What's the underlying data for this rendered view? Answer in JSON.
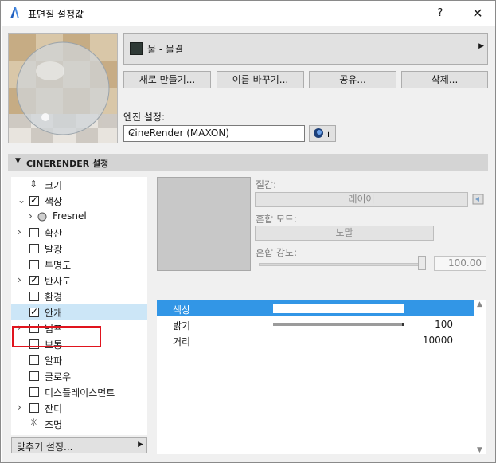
{
  "window": {
    "title": "표면질 설정값",
    "help": "?",
    "close": "✕"
  },
  "material": {
    "name": "물 - 물결",
    "swatch_color": "#2f3a36"
  },
  "buttons": {
    "new": "새로 만들기...",
    "rename": "이름 바꾸기...",
    "share": "공유...",
    "delete": "삭제..."
  },
  "engine": {
    "label": "엔진 설정:",
    "value": "CineRender (MAXON)",
    "info": "i"
  },
  "section": {
    "title": "CINERENDER 설정"
  },
  "channels": [
    {
      "label": "크기",
      "expand": false,
      "checkbox": false,
      "icon": "size-icon"
    },
    {
      "label": "색상",
      "expand": "open",
      "checkbox": true,
      "checked": true
    },
    {
      "label": "Fresnel",
      "expand": "child",
      "checkbox": false,
      "icon": "sphere-icon"
    },
    {
      "label": "확산",
      "expand": true,
      "checkbox": true,
      "checked": false
    },
    {
      "label": "발광",
      "expand": false,
      "checkbox": true,
      "checked": false
    },
    {
      "label": "투명도",
      "expand": false,
      "checkbox": true,
      "checked": false
    },
    {
      "label": "반사도",
      "expand": true,
      "checkbox": true,
      "checked": true
    },
    {
      "label": "환경",
      "expand": false,
      "checkbox": true,
      "checked": false
    },
    {
      "label": "안개",
      "expand": false,
      "checkbox": true,
      "checked": true,
      "selected": true
    },
    {
      "label": "범프",
      "expand": true,
      "checkbox": true,
      "checked": false
    },
    {
      "label": "보통",
      "expand": false,
      "checkbox": true,
      "checked": false
    },
    {
      "label": "알파",
      "expand": false,
      "checkbox": true,
      "checked": false
    },
    {
      "label": "글로우",
      "expand": false,
      "checkbox": true,
      "checked": false
    },
    {
      "label": "디스플레이스먼트",
      "expand": false,
      "checkbox": true,
      "checked": false
    },
    {
      "label": "잔디",
      "expand": true,
      "checkbox": true,
      "checked": false
    },
    {
      "label": "조명",
      "expand": false,
      "checkbox": false,
      "icon": "light-icon"
    }
  ],
  "fit": {
    "label": "맞추기 설정..."
  },
  "texture": {
    "label": "질감:",
    "value": "레이어",
    "blend_label": "혼합 모드:",
    "blend_value": "노말",
    "strength_label": "혼합 강도:",
    "strength_value": "100.00",
    "strength_fraction": 1.0
  },
  "properties": [
    {
      "name": "색상",
      "value": ""
    },
    {
      "name": "밝기",
      "value": "100"
    },
    {
      "name": "거리",
      "value": "10000"
    }
  ]
}
